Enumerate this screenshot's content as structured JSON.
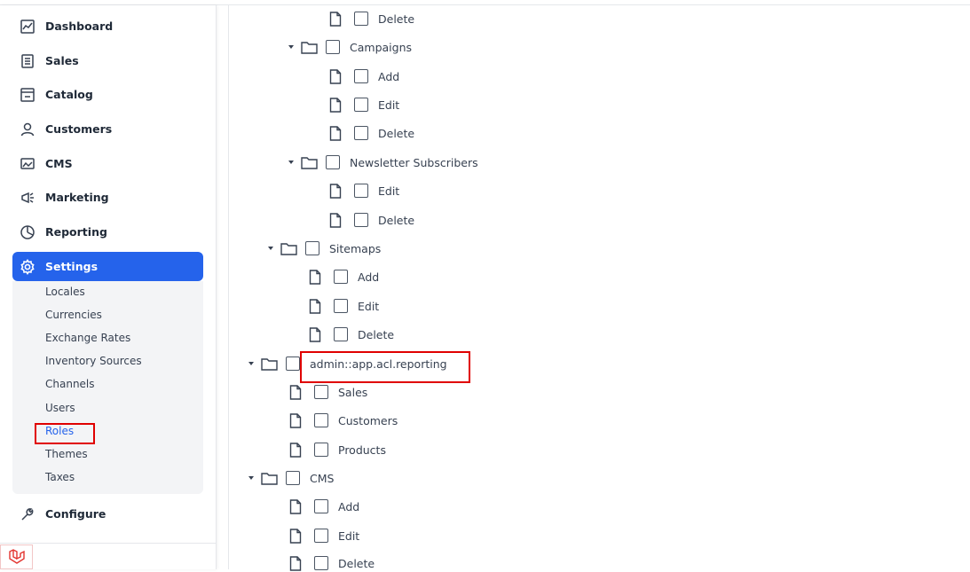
{
  "sidebar": {
    "items": [
      {
        "label": "Dashboard",
        "icon": "dashboard-icon"
      },
      {
        "label": "Sales",
        "icon": "sales-icon"
      },
      {
        "label": "Catalog",
        "icon": "catalog-icon"
      },
      {
        "label": "Customers",
        "icon": "customers-icon"
      },
      {
        "label": "CMS",
        "icon": "cms-icon"
      },
      {
        "label": "Marketing",
        "icon": "marketing-icon"
      },
      {
        "label": "Reporting",
        "icon": "reporting-icon"
      },
      {
        "label": "Settings",
        "icon": "settings-icon"
      },
      {
        "label": "Configure",
        "icon": "configure-icon"
      }
    ],
    "settings_sub": [
      "Locales",
      "Currencies",
      "Exchange Rates",
      "Inventory Sources",
      "Channels",
      "Users",
      "Roles",
      "Themes",
      "Taxes"
    ],
    "active_item": "Settings",
    "active_sub": "Roles"
  },
  "tree": {
    "rows": [
      {
        "label": "Delete",
        "kind": "file"
      },
      {
        "label": "Campaigns",
        "kind": "folder"
      },
      {
        "label": "Add",
        "kind": "file"
      },
      {
        "label": "Edit",
        "kind": "file"
      },
      {
        "label": "Delete",
        "kind": "file"
      },
      {
        "label": "Newsletter Subscribers",
        "kind": "folder"
      },
      {
        "label": "Edit",
        "kind": "file"
      },
      {
        "label": "Delete",
        "kind": "file"
      },
      {
        "label": "Sitemaps",
        "kind": "folder"
      },
      {
        "label": "Add",
        "kind": "file"
      },
      {
        "label": "Edit",
        "kind": "file"
      },
      {
        "label": "Delete",
        "kind": "file"
      },
      {
        "label": "admin::app.acl.reporting",
        "kind": "folder"
      },
      {
        "label": "Sales",
        "kind": "file"
      },
      {
        "label": "Customers",
        "kind": "file"
      },
      {
        "label": "Products",
        "kind": "file"
      },
      {
        "label": "CMS",
        "kind": "folder"
      },
      {
        "label": "Add",
        "kind": "file"
      },
      {
        "label": "Edit",
        "kind": "file"
      },
      {
        "label": "Delete",
        "kind": "file"
      }
    ]
  },
  "colors": {
    "accent": "#2563eb",
    "highlight": "#e00000"
  },
  "footer": {
    "logo_icon": "laravel-logo-icon"
  }
}
